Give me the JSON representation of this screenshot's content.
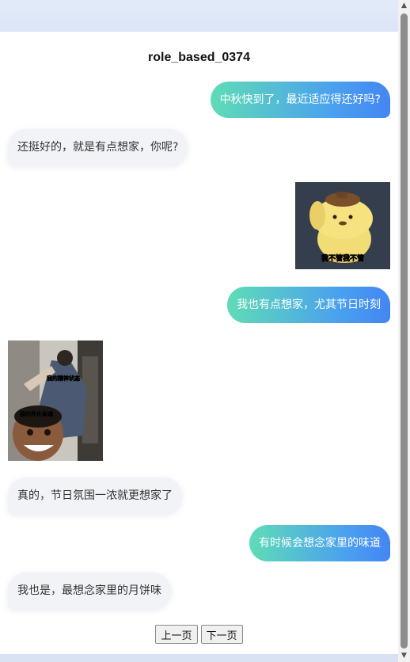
{
  "conversation": {
    "title": "role_based_0374",
    "messages": [
      {
        "role": "user",
        "text": "中秋快到了，最近适应得还好吗?"
      },
      {
        "role": "bot",
        "text": "还挺好的，就是有点想家，你呢?"
      },
      {
        "role": "user",
        "sticker": "pompompurin-sticker",
        "caption": "我不管我不管"
      },
      {
        "role": "user",
        "text": "我也有点想家，尤其节日时刻"
      },
      {
        "role": "bot",
        "sticker": "meme-sticker",
        "caption_top": "我的精神状态",
        "caption_bottom": "我的外在表现"
      },
      {
        "role": "bot",
        "text": "真的，节日氛围一浓就更想家了"
      },
      {
        "role": "user",
        "text": "有时候会想念家里的味道"
      },
      {
        "role": "bot",
        "text": "我也是，最想念家里的月饼味"
      }
    ]
  },
  "pager": {
    "prev_label": "上一页",
    "next_label": "下一页"
  },
  "colors": {
    "user_bubble_start": "#5fdcb6",
    "user_bubble_end": "#4386f2",
    "bot_bubble": "#f1f3f7"
  }
}
